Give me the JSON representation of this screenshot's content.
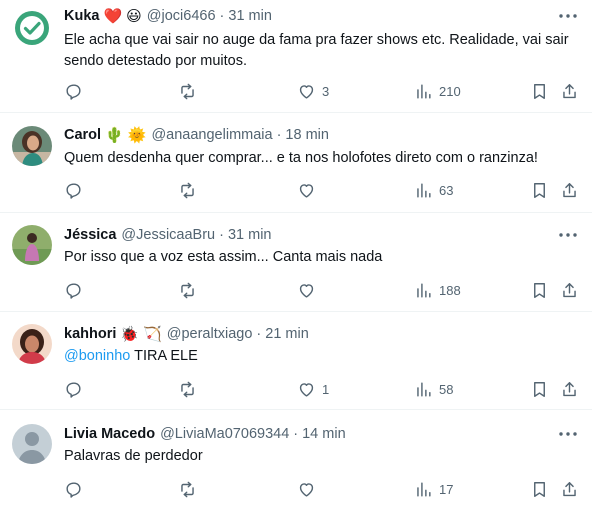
{
  "tweets": [
    {
      "name": "Kuka",
      "emojis": [
        "❤️",
        "😃"
      ],
      "handle": "@joci6466",
      "time": "31 min",
      "text": "Ele acha que vai sair no auge da fama pra fazer shows etc. Realidade, vai sair sendo detestado por muitos.",
      "likes": "3",
      "views": "210"
    },
    {
      "name": "Carol",
      "emojis": [
        "🌵",
        "🌞"
      ],
      "handle": "@anaangelimmaia",
      "time": "18 min",
      "text": "Quem desdenha quer comprar... e ta nos holofotes direto com o ranzinza!",
      "likes": "",
      "views": "63"
    },
    {
      "name": "Jéssica",
      "emojis": [],
      "handle": "@JessicaaBru",
      "time": "31 min",
      "text": "Por isso que a voz esta assim... Canta mais nada",
      "likes": "",
      "views": "188"
    },
    {
      "name": "kahhori",
      "emojis": [
        "🐞",
        "🏹"
      ],
      "handle": "@peraltxiago",
      "time": "21 min",
      "mention": "@boninho",
      "text": " TIRA ELE",
      "likes": "1",
      "views": "58"
    },
    {
      "name": "Livia Macedo",
      "emojis": [],
      "handle": "@LiviaMa07069344",
      "time": "14 min",
      "text": "Palavras de perdedor",
      "likes": "",
      "views": "17"
    }
  ],
  "dot": "·",
  "colors": {
    "accent": "#1d9bf0",
    "muted": "#536471",
    "divider": "#eff3f4"
  },
  "icons": [
    "more-icon",
    "reply-icon",
    "retweet-icon",
    "like-icon",
    "views-icon",
    "bookmark-icon",
    "share-icon"
  ]
}
